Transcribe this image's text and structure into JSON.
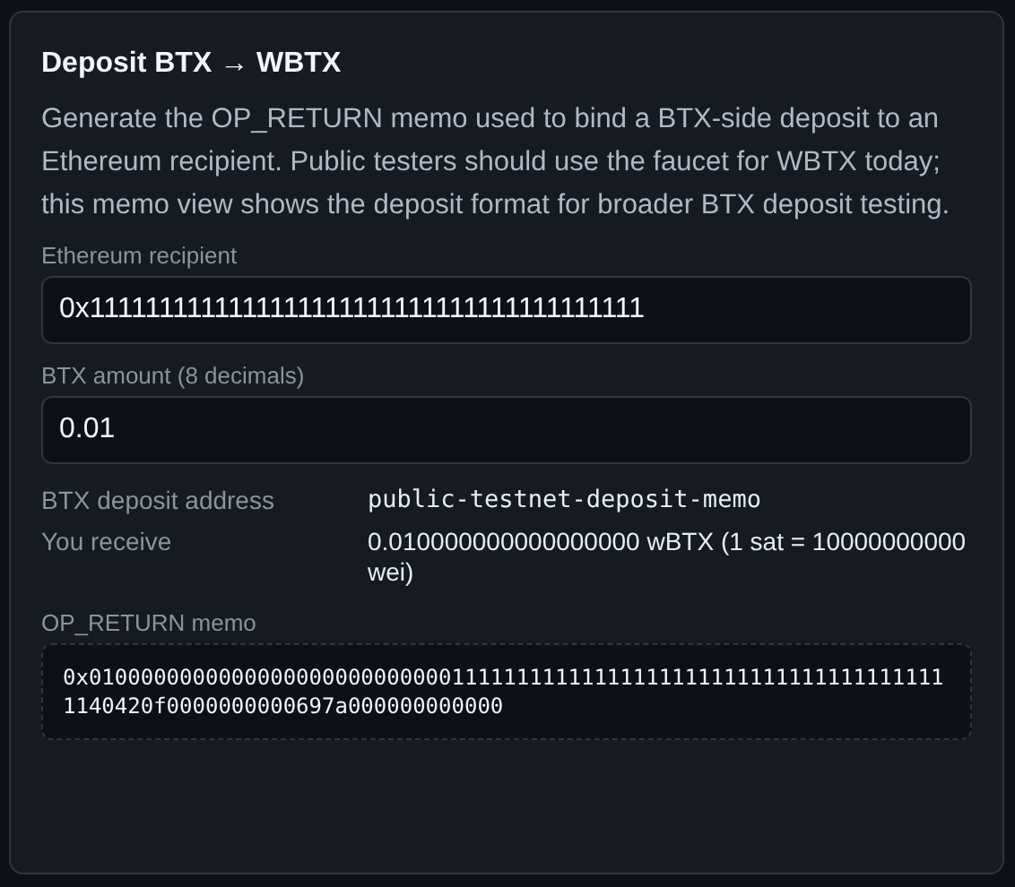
{
  "card": {
    "title": "Deposit BTX → WBTX",
    "description": "Generate the OP_RETURN memo used to bind a BTX-side deposit to an Ethereum recipient. Public testers should use the faucet for WBTX today; this memo view shows the deposit format for broader BTX deposit testing.",
    "fields": [
      {
        "label": "Ethereum recipient",
        "value": "0x1111111111111111111111111111111111111111"
      },
      {
        "label": "BTX amount (8 decimals)",
        "value": "0.01"
      }
    ],
    "details": [
      {
        "label": "BTX deposit address",
        "value": "public-testnet-deposit-memo",
        "kind": "mono"
      },
      {
        "label": "You receive",
        "value": "0.010000000000000000 wBTX (1 sat = 10000000000 wei)",
        "kind": "text"
      }
    ],
    "memo": {
      "label": "OP_RETURN memo",
      "value": "0x0100000000000000000000000000111111111111111111111111111111111111111140420f0000000000697a000000000000"
    }
  }
}
